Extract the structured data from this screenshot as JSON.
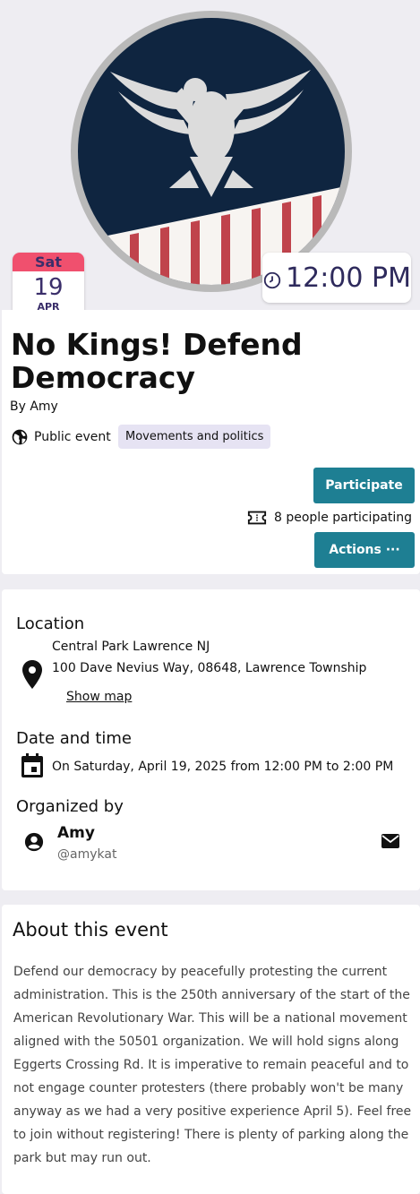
{
  "event": {
    "date_tile": {
      "weekday": "Sat",
      "day": "19",
      "month": "APR"
    },
    "time": "12:00 PM",
    "title": "No Kings! Defend Democracy",
    "by": "By Amy",
    "visibility": "Public event",
    "category": "Movements and politics",
    "participate_label": "Participate",
    "participants": "8 people participating",
    "actions_label": "Actions ···"
  },
  "details": {
    "location_heading": "Location",
    "location_name": "Central Park Lawrence NJ",
    "address": "100 Dave Nevius Way, 08648, Lawrence Township",
    "show_map": "Show map",
    "datetime_heading": "Date and time",
    "datetime": "On Saturday, April 19, 2025 from 12:00 PM to 2:00 PM",
    "organizer_heading": "Organized by",
    "organizer_name": "Amy",
    "organizer_handle": "@amykat"
  },
  "about": {
    "heading": "About this event",
    "text": "Defend our democracy by peacefully protesting the current administration. This is the 250th anniversary of the start of the American Revolutionary War. This will be a national movement aligned with the 50501 organization. We will hold signs along Eggerts Crossing Rd. It is imperative to remain peaceful and to not engage counter protesters (there probably won't be many anyway as we had a very positive experience April 5). Feel free to join without registering! There is plenty of parking along the park but may run out."
  },
  "colors": {
    "accent": "#1e7f93",
    "date_header": "#f0506e",
    "navy": "#0f2540",
    "stripe_red": "#c0434c"
  },
  "icons": [
    "clock-icon",
    "globe-icon",
    "ticket-icon",
    "map-pin-icon",
    "calendar-icon",
    "account-circle-icon",
    "email-icon"
  ]
}
